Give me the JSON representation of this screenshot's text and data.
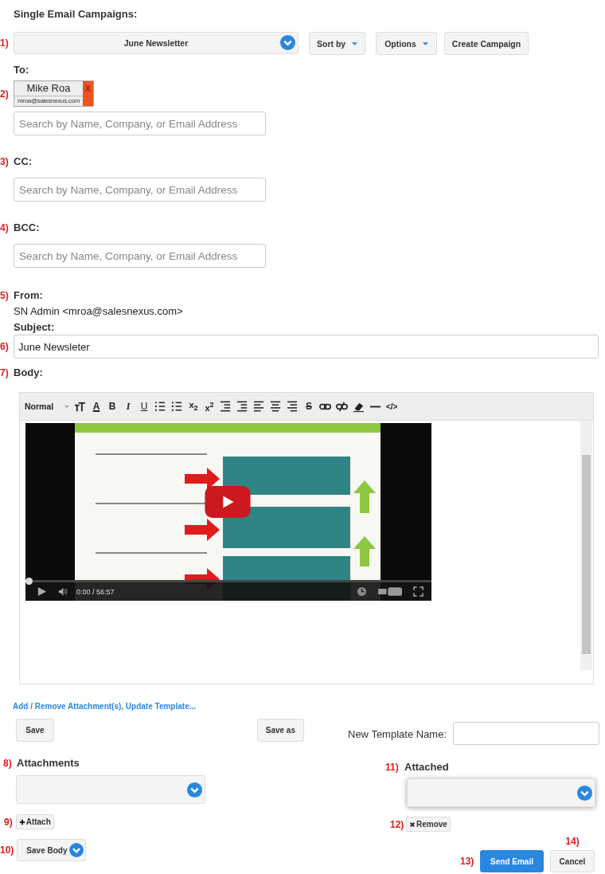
{
  "title": "Single Email Campaigns:",
  "campaign": {
    "marker": "1)",
    "value": "June Newsletter"
  },
  "top_buttons": [
    {
      "label": "Sort by",
      "kind": "dropdown"
    },
    {
      "label": "Options",
      "kind": "dropdown"
    },
    {
      "label": "Create Campaign",
      "kind": "plain"
    }
  ],
  "to": {
    "label": "To:",
    "marker": "2)",
    "recipients": [
      {
        "name": "Mike Roa",
        "email": "mroa@salesnexus.com",
        "remove": "X"
      }
    ],
    "placeholder": "Search by Name, Company, or Email Address"
  },
  "cc": {
    "marker": "3)",
    "label": "CC:",
    "placeholder": "Search by Name, Company, or Email Address"
  },
  "bcc": {
    "marker": "4)",
    "label": "BCC:",
    "placeholder": "Search by Name, Company, or Email Address"
  },
  "from": {
    "marker": "5)",
    "label": "From:",
    "value": "SN Admin <mroa@salesnexus.com>"
  },
  "subject": {
    "label": "Subject:",
    "marker": "6)",
    "value": "June Newsleter"
  },
  "body": {
    "marker": "7)",
    "label": "Body:",
    "format": "Normal",
    "tools": [
      {
        "kind": "font-size"
      },
      {
        "kind": "color",
        "glyph": "A"
      },
      {
        "kind": "bold",
        "glyph": "B"
      },
      {
        "kind": "italic",
        "glyph": "I"
      },
      {
        "kind": "underline",
        "glyph": "U"
      },
      {
        "kind": "ordered-list"
      },
      {
        "kind": "bullet-list"
      },
      {
        "kind": "script",
        "glyph": "x$_{2}$"
      },
      {
        "kind": "script",
        "glyph": "x$^{2}$"
      },
      {
        "kind": "outdent"
      },
      {
        "kind": "indent"
      },
      {
        "kind": "align-left"
      },
      {
        "kind": "align-center"
      },
      {
        "kind": "align-right"
      },
      {
        "kind": "strike",
        "glyph": "S"
      },
      {
        "kind": "link"
      },
      {
        "kind": "unlink"
      },
      {
        "kind": "eraser"
      },
      {
        "kind": "rule"
      },
      {
        "kind": "code",
        "glyph": "</>"
      }
    ],
    "video": {
      "time": "0:00 / 56:57",
      "level": 0
    }
  },
  "link": "Add / Remove Attachment(s), Update Template...",
  "save_button": "Save",
  "save_as_button": "Save as",
  "template_name": {
    "label": "New Template Name:"
  },
  "attachments": {
    "marker": "8)",
    "label": "Attachments"
  },
  "attach_button": {
    "marker": "9)",
    "label": "Attach"
  },
  "save_body": {
    "marker": "10)",
    "label": "Save Body"
  },
  "attached": {
    "marker": "11)",
    "label": "Attached"
  },
  "remove_button": {
    "marker": "12)",
    "label": "Remove"
  },
  "send": {
    "marker": "13)",
    "label": "Send Email"
  },
  "cancel": {
    "marker": "14)",
    "label": "Cancel"
  }
}
